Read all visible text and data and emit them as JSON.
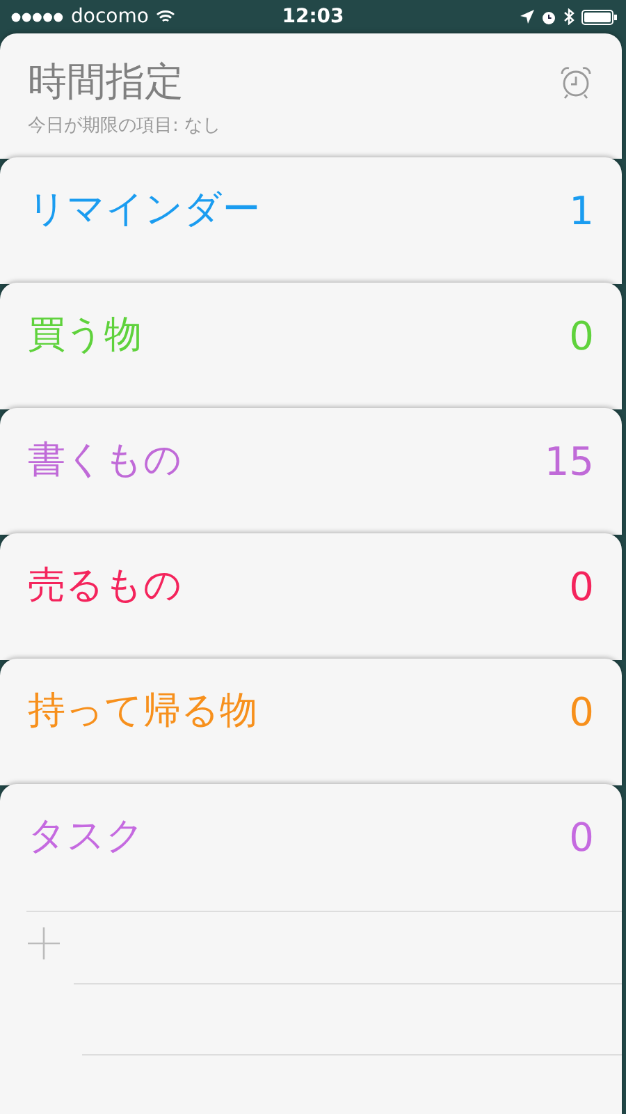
{
  "status_bar": {
    "carrier": "docomo",
    "time": "12:03"
  },
  "header": {
    "title": "時間指定",
    "subtitle": "今日が期限の項目: なし"
  },
  "lists": [
    {
      "name": "リマインダー",
      "count": "1",
      "color": "#1a9cf0"
    },
    {
      "name": "買う物",
      "count": "0",
      "color": "#5fd23c"
    },
    {
      "name": "書くもの",
      "count": "15",
      "color": "#c06ad8"
    },
    {
      "name": "売るもの",
      "count": "0",
      "color": "#f4245c"
    },
    {
      "name": "持って帰る物",
      "count": "0",
      "color": "#f7901c"
    },
    {
      "name": "タスク",
      "count": "0",
      "color": "#c56ae0"
    }
  ]
}
